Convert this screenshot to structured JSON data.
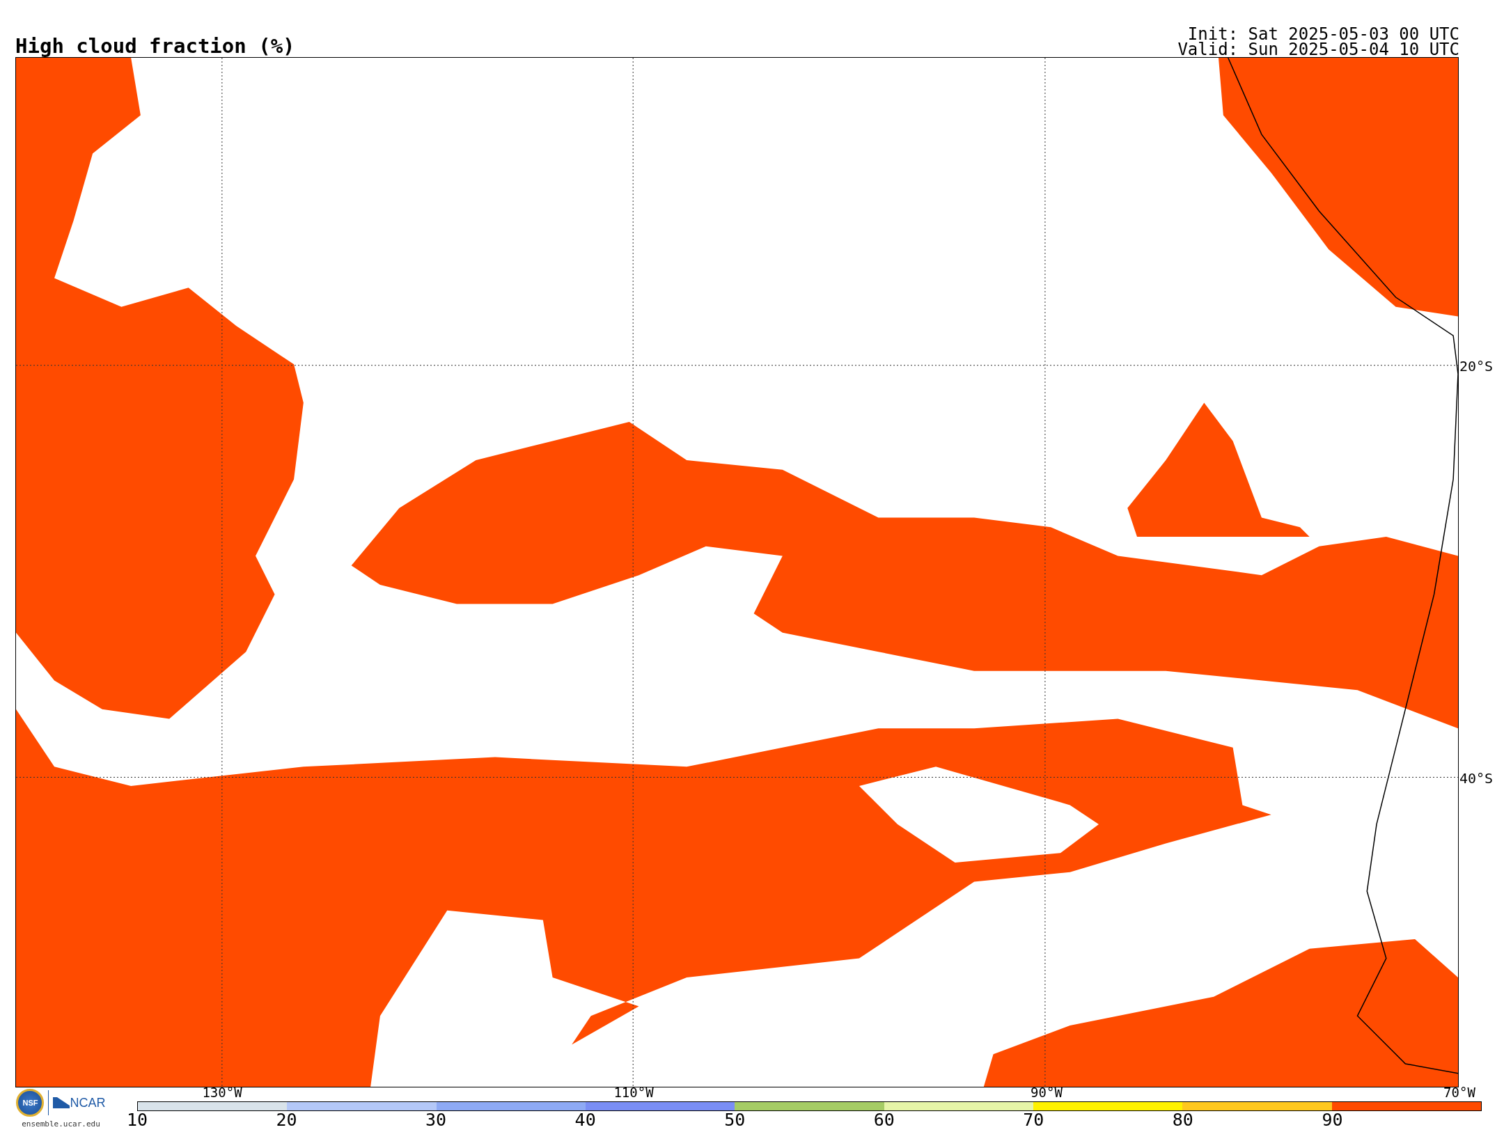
{
  "title": "High cloud fraction (%)",
  "init": "Init: Sat 2025-05-03 00 UTC",
  "valid": "Valid: Sun 2025-05-04 10 UTC",
  "map": {
    "longitude_labels": [
      "130°W",
      "110°W",
      "90°W",
      "70°W"
    ],
    "latitude_labels": [
      "20°S",
      "40°S"
    ]
  },
  "logo": {
    "agency": "NSF",
    "lab": "NCAR",
    "site": "ensemble.ucar.edu"
  },
  "colorbar": {
    "bins": [
      {
        "color": "#d9e3ea"
      },
      {
        "color": "#b4c8f8"
      },
      {
        "color": "#8eaaf5"
      },
      {
        "color": "#7a8ef5"
      },
      {
        "color": "#a5cc65"
      },
      {
        "color": "#e6f5a8"
      },
      {
        "color": "#fff200"
      },
      {
        "color": "#ffc81e"
      },
      {
        "color": "#ff4b00"
      }
    ],
    "labels": [
      "10",
      "20",
      "30",
      "40",
      "50",
      "60",
      "70",
      "80",
      "90"
    ]
  }
}
